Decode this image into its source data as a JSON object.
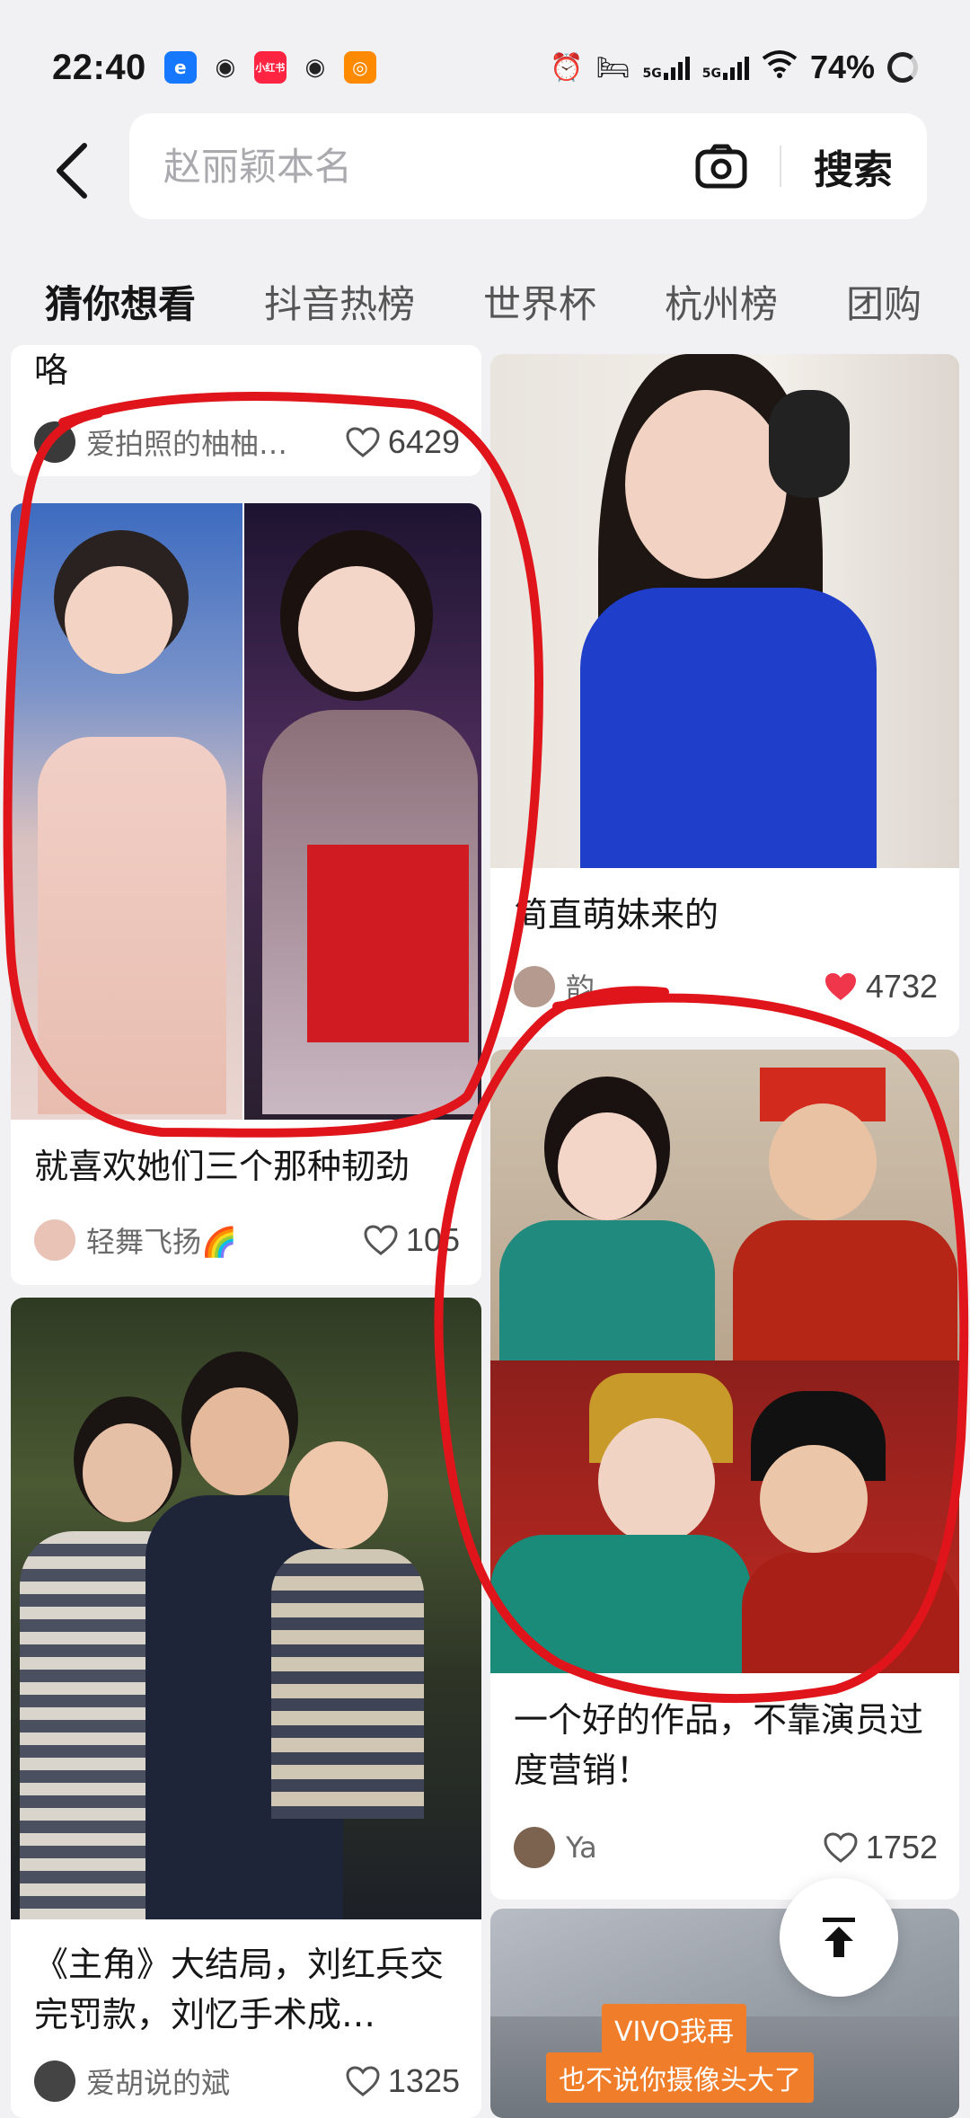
{
  "status_bar": {
    "time": "22:40",
    "network_labels": [
      "5G",
      "5G"
    ],
    "battery": "74%"
  },
  "header": {
    "search_placeholder": "赵丽颖本名",
    "search_button": "搜索"
  },
  "tabs": [
    "猜你想看",
    "抖音热榜",
    "世界杯",
    "杭州榜",
    "团购"
  ],
  "feed": {
    "left": [
      {
        "title": "咯",
        "author": "爱拍照的柚柚…",
        "likes": "6429"
      },
      {
        "title": "就喜欢她们三个那种韧劲",
        "author": "轻舞飞扬🌈",
        "likes": "105"
      },
      {
        "title": "《主角》大结局，刘红兵交完罚款，刘忆手术成…",
        "author": "爱胡说的斌",
        "likes": "1325"
      }
    ],
    "right": [
      {
        "title": "简直萌妹来的",
        "author": "韵",
        "likes": "4732",
        "liked": true
      },
      {
        "title": "一个好的作品，不靠演员过度营销！",
        "author": "Ya",
        "likes": "1752"
      },
      {
        "overlay_line1": "VIVO我再",
        "overlay_line2": "也不说你摄像头大了"
      }
    ]
  },
  "colors": {
    "accent_red": "#e0151b",
    "like_red": "#f0364a",
    "background": "#f1f1f3"
  }
}
